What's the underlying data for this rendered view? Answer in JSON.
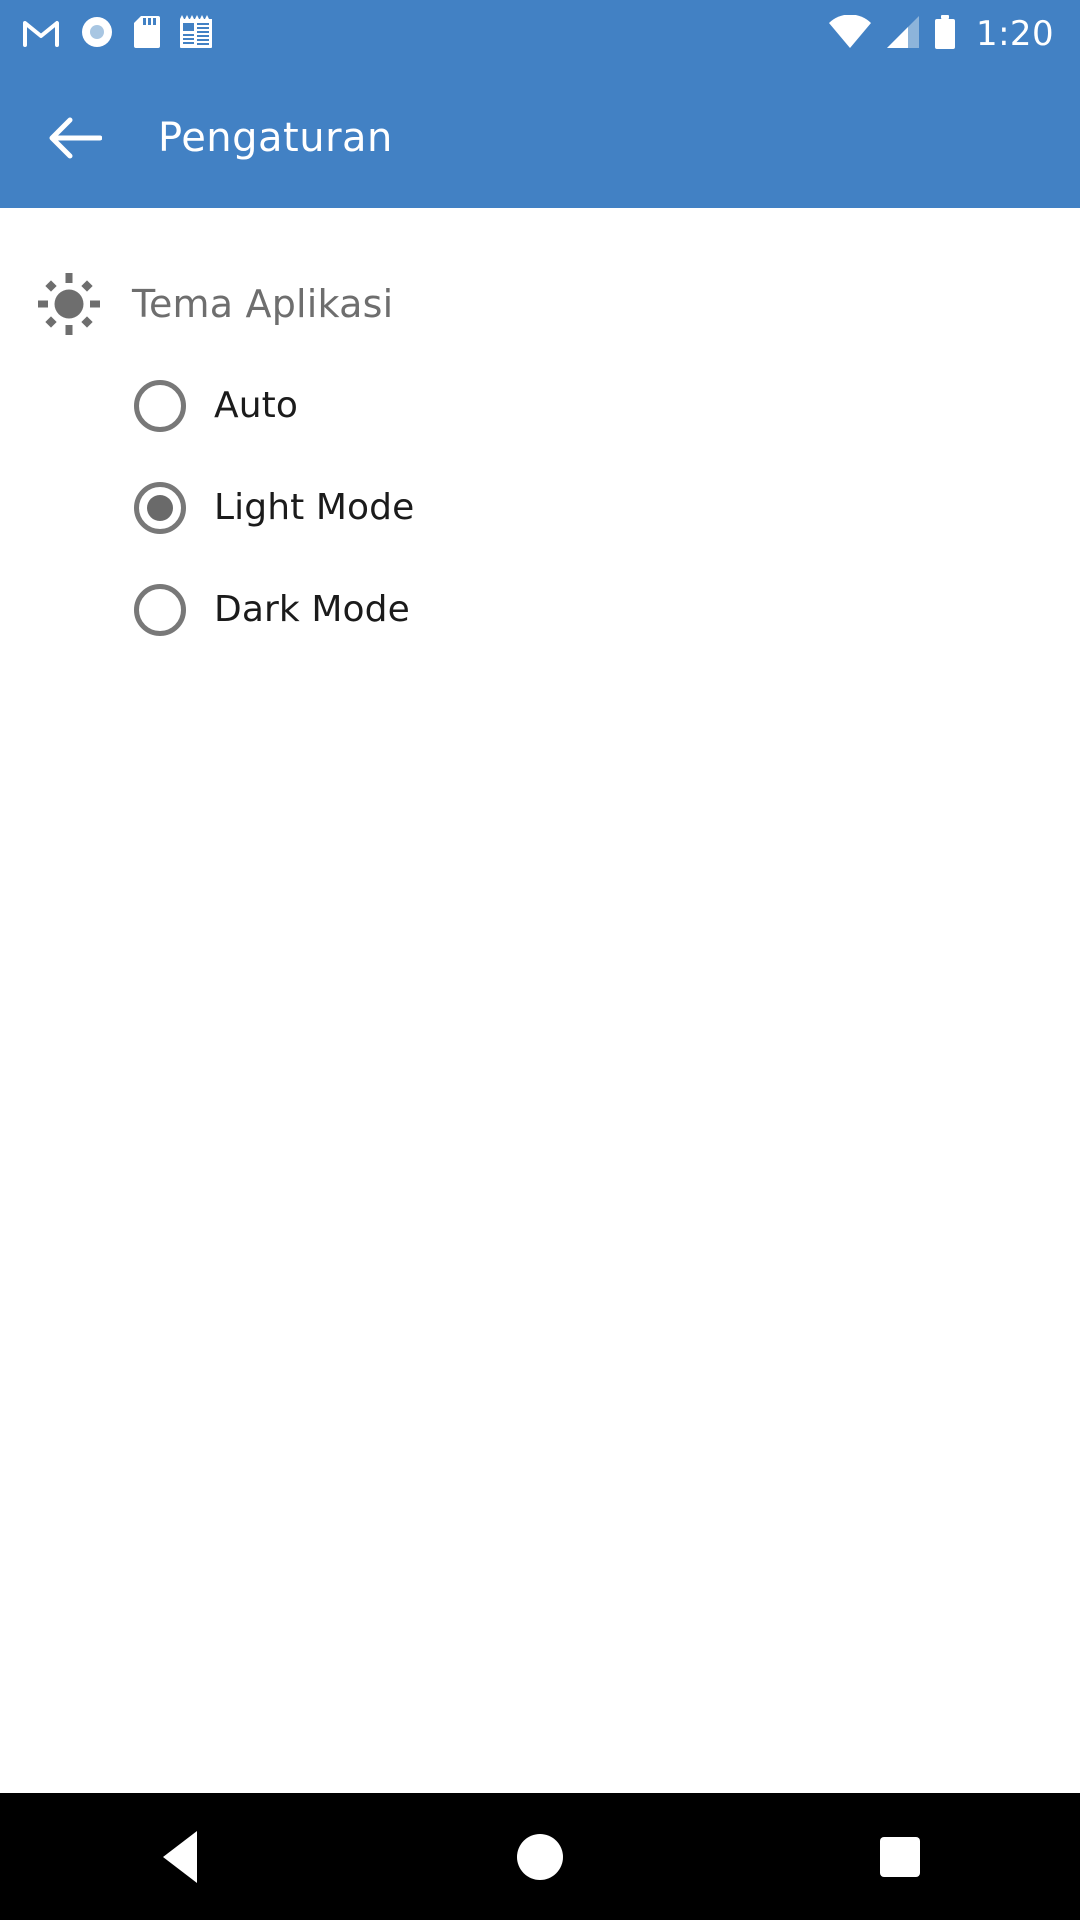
{
  "status_bar": {
    "background": "#4281c4",
    "time": "1:20",
    "left_icons": [
      {
        "name": "gmail-icon",
        "label": "Gmail"
      },
      {
        "name": "record-icon",
        "label": "Screen recorder"
      },
      {
        "name": "sd-card-icon",
        "label": "SD card"
      },
      {
        "name": "news-icon",
        "label": "Notes"
      }
    ],
    "right_icons": [
      {
        "name": "wifi-icon",
        "label": "Wi-Fi"
      },
      {
        "name": "cellular-signal-icon",
        "label": "Mobile signal"
      },
      {
        "name": "battery-icon",
        "label": "Battery"
      }
    ]
  },
  "app_bar": {
    "background": "#4281c4",
    "back_label": "Kembali",
    "title": "Pengaturan"
  },
  "settings": {
    "theme_section": {
      "icon": "sun-brightness-icon",
      "title": "Tema Aplikasi",
      "title_color": "#6e6e6e",
      "selected": "Light Mode",
      "options": [
        {
          "label": "Auto",
          "checked": false
        },
        {
          "label": "Light Mode",
          "checked": true
        },
        {
          "label": "Dark Mode",
          "checked": false
        }
      ]
    }
  },
  "nav_bar": {
    "background": "#000000",
    "buttons": [
      {
        "name": "nav-back-button",
        "label": "Back"
      },
      {
        "name": "nav-home-button",
        "label": "Home"
      },
      {
        "name": "nav-recents-button",
        "label": "Recents"
      }
    ]
  }
}
